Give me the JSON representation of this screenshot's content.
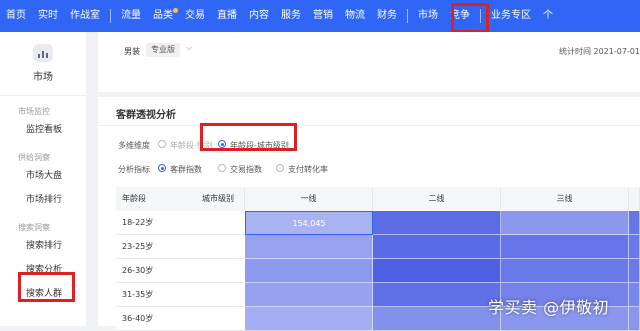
{
  "topnav": {
    "items": [
      {
        "label": "首页",
        "dot": false
      },
      {
        "label": "实时",
        "dot": false
      },
      {
        "label": "作战室",
        "dot": false
      },
      {
        "label": "流量",
        "dot": false
      },
      {
        "label": "品类",
        "dot": true
      },
      {
        "label": "交易",
        "dot": false
      },
      {
        "label": "直播",
        "dot": false
      },
      {
        "label": "内容",
        "dot": false
      },
      {
        "label": "服务",
        "dot": false
      },
      {
        "label": "营销",
        "dot": false
      },
      {
        "label": "物流",
        "dot": false
      },
      {
        "label": "财务",
        "dot": false
      },
      {
        "label": "市场",
        "dot": false
      },
      {
        "label": "竞争",
        "dot": false
      },
      {
        "label": "业务专区",
        "dot": false
      },
      {
        "label": "个",
        "dot": false
      }
    ],
    "active": "市场"
  },
  "sidebar": {
    "title": "市场",
    "groups": [
      {
        "label": "市场监控",
        "items": [
          "监控看板"
        ]
      },
      {
        "label": "供给洞察",
        "items": [
          "市场大盘",
          "市场排行"
        ]
      },
      {
        "label": "搜索洞察",
        "items": [
          "搜索排行",
          "搜索分析",
          "搜索人群"
        ]
      }
    ]
  },
  "filterbar": {
    "category": "男装",
    "edition": "专业版",
    "stat_time": "统计时间 2021-07-01"
  },
  "panel": {
    "title": "客群透视分析",
    "dimension_label": "多维维度",
    "dimension_options": [
      "年龄段-性别",
      "年龄段-城市级别"
    ],
    "dimension_selected": 1,
    "metric_label": "分析指标",
    "metric_options": [
      "客群指数",
      "交易指数",
      "支付转化率"
    ],
    "metric_selected": 0
  },
  "table": {
    "corner_left": "年龄段",
    "corner_right": "城市级别",
    "columns": [
      "一线",
      "二线",
      "三线"
    ],
    "rows": [
      "18-22岁",
      "23-25岁",
      "26-30岁",
      "31-35岁",
      "36-40岁"
    ],
    "cells": [
      [
        "154,045",
        "",
        "",
        ""
      ],
      [
        "",
        "",
        "",
        ""
      ],
      [
        "",
        "",
        "",
        ""
      ],
      [
        "",
        "",
        "",
        ""
      ],
      [
        "",
        "",
        "",
        ""
      ]
    ],
    "shade": [
      [
        "#aab3f2",
        "#5b6ce6",
        "#8c97ee",
        "#6675e8"
      ],
      [
        "#98a3f0",
        "#5a6be6",
        "#6676e9",
        "#6a78e9"
      ],
      [
        "#8d99ef",
        "#4f60e3",
        "#6a79e9",
        "#6b79ea"
      ],
      [
        "#96a1f0",
        "#6070e6",
        "#7482ea",
        "#7986eb"
      ],
      [
        "#a5aef2",
        "#8390ec",
        "#8b97ee",
        "#8995ee"
      ]
    ]
  },
  "watermark": "学买卖 @伊敬初"
}
